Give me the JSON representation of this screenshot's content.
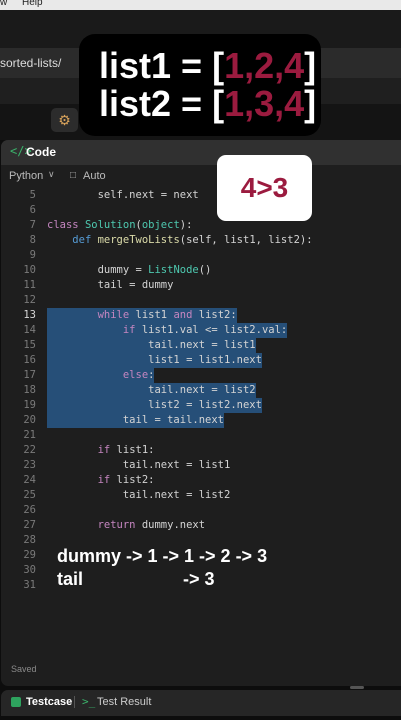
{
  "menubar": {
    "items": [
      "w",
      "Help"
    ]
  },
  "browser": {
    "url_fragment": "sorted-lists/"
  },
  "overlay": {
    "line1": {
      "prefix": "list1 = ",
      "open": "[",
      "values": "1,2,4",
      "close": "]"
    },
    "line2": {
      "prefix": "list2 = ",
      "open": "[",
      "values": "1,3,4",
      "close": "]"
    }
  },
  "panel": {
    "title": "Code",
    "language": "Python",
    "mode": "Auto"
  },
  "comparison_badge": "4>3",
  "code_lines": [
    {
      "n": "5",
      "text": "        self.next = next"
    },
    {
      "n": "6",
      "text": ""
    },
    {
      "n": "7",
      "text": "class Solution(object):"
    },
    {
      "n": "8",
      "text": "    def mergeTwoLists(self, list1, list2):"
    },
    {
      "n": "9",
      "text": ""
    },
    {
      "n": "10",
      "text": "        dummy = ListNode()"
    },
    {
      "n": "11",
      "text": "        tail = dummy"
    },
    {
      "n": "12",
      "text": ""
    },
    {
      "n": "13",
      "text": "        while list1 and list2:"
    },
    {
      "n": "14",
      "text": "            if list1.val <= list2.val:"
    },
    {
      "n": "15",
      "text": "                tail.next = list1"
    },
    {
      "n": "16",
      "text": "                list1 = list1.next"
    },
    {
      "n": "17",
      "text": "            else:"
    },
    {
      "n": "18",
      "text": "                tail.next = list2"
    },
    {
      "n": "19",
      "text": "                list2 = list2.next"
    },
    {
      "n": "20",
      "text": "            tail = tail.next"
    },
    {
      "n": "21",
      "text": ""
    },
    {
      "n": "22",
      "text": "        if list1:"
    },
    {
      "n": "23",
      "text": "            tail.next = list1"
    },
    {
      "n": "24",
      "text": "        if list2:"
    },
    {
      "n": "25",
      "text": "            tail.next = list2"
    },
    {
      "n": "26",
      "text": ""
    },
    {
      "n": "27",
      "text": "        return dummy.next"
    },
    {
      "n": "28",
      "text": ""
    },
    {
      "n": "29",
      "text": ""
    },
    {
      "n": "30",
      "text": ""
    },
    {
      "n": "31",
      "text": ""
    }
  ],
  "active_line": "13",
  "selected_lines": [
    "13",
    "14",
    "15",
    "16",
    "17",
    "18",
    "19",
    "20"
  ],
  "trace": {
    "line1": "dummy -> 1 -> 1 -> 2 -> 3",
    "line2": "tail                    -> 3"
  },
  "status": "Saved",
  "bottom_tabs": {
    "testcase": "Testcase",
    "test_result": "Test Result"
  }
}
